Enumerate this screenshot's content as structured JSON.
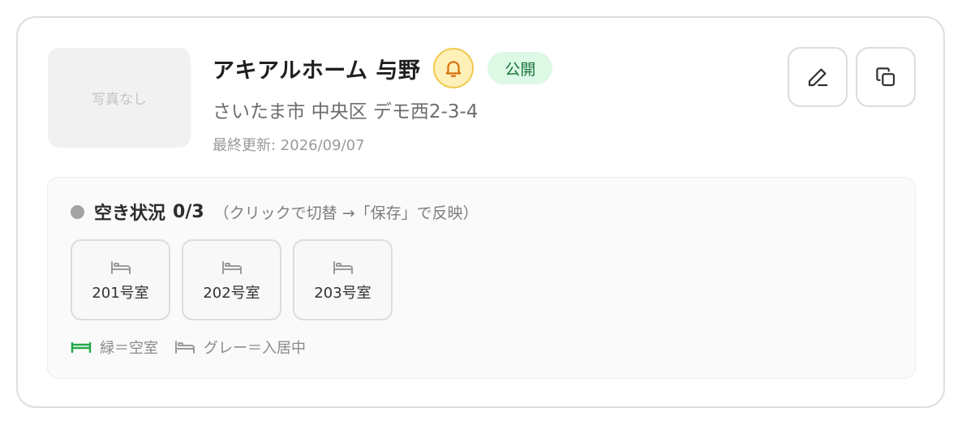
{
  "property": {
    "photo_placeholder": "写真なし",
    "name": "アキアルホーム 与野",
    "status_badge": "公開",
    "address": "さいたま市 中央区 デモ西2-3-4",
    "last_updated": "最終更新: 2026/09/07"
  },
  "actions": {
    "edit_icon": "pencil-icon",
    "copy_icon": "copy-icon"
  },
  "vacancy": {
    "title": "空き状況",
    "count": "0/3",
    "hint": "（クリックで切替 →「保存」で反映）",
    "rooms": [
      {
        "label": "201号室",
        "status": "occupied"
      },
      {
        "label": "202号室",
        "status": "occupied"
      },
      {
        "label": "203号室",
        "status": "occupied"
      }
    ],
    "legend": {
      "vacant": "緑＝空室",
      "occupied": "グレー＝入居中"
    }
  },
  "colors": {
    "vacant": "#22a84a",
    "occupied": "#9a9a9a",
    "badge_bg": "#ddf8e4",
    "badge_text": "#16753a",
    "bell_bg": "#fdf0b8",
    "bell_stroke": "#d9700b"
  }
}
